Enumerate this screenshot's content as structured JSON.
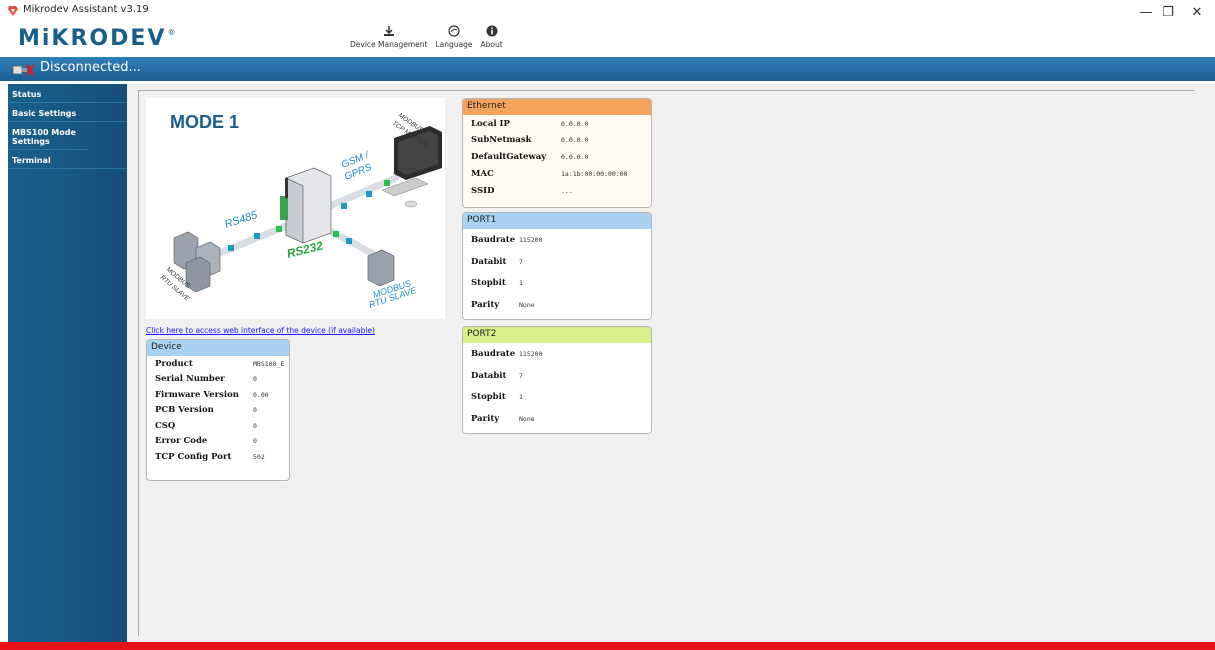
{
  "window": {
    "title": "Mikrodev Assistant v3.19",
    "minimize": "—",
    "maximize": "❐",
    "close": "✕"
  },
  "logo": {
    "text": "MiKRODEV",
    "reg": "®"
  },
  "toolbar": [
    {
      "label": "Device Management",
      "icon": "download-icon"
    },
    {
      "label": "Language",
      "icon": "globe-icon"
    },
    {
      "label": "About",
      "icon": "info-icon"
    }
  ],
  "status": {
    "text": "Disconnected...",
    "icon": "disconnected-cable-icon"
  },
  "sidebar": {
    "items": [
      {
        "label": "Status"
      },
      {
        "label": "Basic Settings"
      },
      {
        "label": "MBS100 Mode Settings"
      },
      {
        "label": "Terminal"
      }
    ]
  },
  "diagram": {
    "title": "MODE 1",
    "labels": {
      "rs485": "RS485",
      "rs232": "RS232",
      "gsm": "GSM /",
      "gprs": "GPRS",
      "tcp1": "MODBUS",
      "tcp2": "TCP MASTER",
      "rtu_left1": "MODBUS",
      "rtu_left2": "RTU SLAVE",
      "rtu_right1": "MODBUS",
      "rtu_right2": "RTU SLAVE"
    }
  },
  "web_link": "Click here to access web interface of the device (if available)",
  "device": {
    "title": "Device",
    "rows": [
      {
        "key": "Product",
        "value": "MBS100_E"
      },
      {
        "key": "Serial Number",
        "value": "0"
      },
      {
        "key": "Firmware Version",
        "value": "0.00"
      },
      {
        "key": "PCB Version",
        "value": "0"
      },
      {
        "key": "CSQ",
        "value": "0"
      },
      {
        "key": "Error Code",
        "value": "0"
      },
      {
        "key": "TCP Config Port",
        "value": "502"
      }
    ]
  },
  "ethernet": {
    "title": "Ethernet",
    "rows": [
      {
        "key": "Local IP",
        "value": "0.0.0.0"
      },
      {
        "key": "SubNetmask",
        "value": "0.0.0.0"
      },
      {
        "key": "DefaultGateway",
        "value": "0.0.0.0"
      },
      {
        "key": "MAC",
        "value": "1a:1b:00:00:00:00"
      },
      {
        "key": "SSID",
        "value": "..."
      }
    ]
  },
  "port1": {
    "title": "PORT1",
    "rows": [
      {
        "key": "Baudrate",
        "value": "115200"
      },
      {
        "key": "Databit",
        "value": "7"
      },
      {
        "key": "Stopbit",
        "value": "1"
      },
      {
        "key": "Parity",
        "value": "None"
      }
    ]
  },
  "port2": {
    "title": "PORT2",
    "rows": [
      {
        "key": "Baudrate",
        "value": "115200"
      },
      {
        "key": "Databit",
        "value": "7"
      },
      {
        "key": "Stopbit",
        "value": "1"
      },
      {
        "key": "Parity",
        "value": "None"
      }
    ]
  },
  "colors": {
    "brand": "#1a5f8c",
    "ethernet_header": "#f4a25c",
    "port1_header": "#a8d2f0",
    "port2_header": "#d9ef8a",
    "device_header": "#a8d2f0",
    "bottom_bar": "#e8131a"
  }
}
